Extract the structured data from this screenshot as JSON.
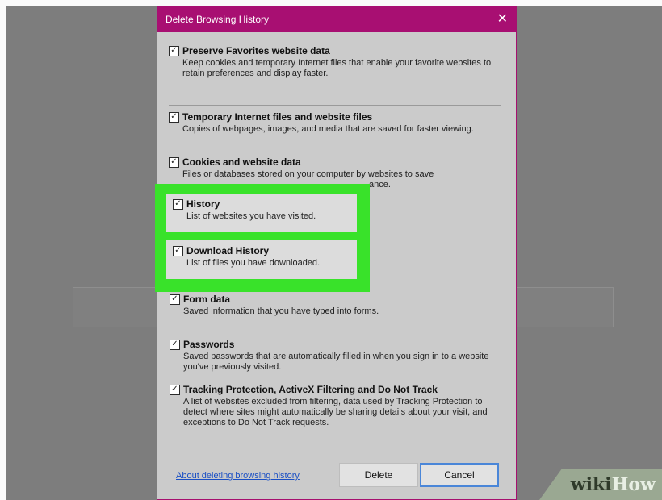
{
  "dialog": {
    "title": "Delete Browsing History",
    "close_glyph": "✕"
  },
  "options": [
    {
      "label": "Preserve Favorites website data",
      "desc": "Keep cookies and temporary Internet files that enable your favorite websites to retain preferences and display faster.",
      "checked": true
    },
    {
      "label": "Temporary Internet files and website files",
      "desc": "Copies of webpages, images, and media that are saved for faster viewing.",
      "checked": true
    },
    {
      "label": "Cookies and website data",
      "desc": "Files or databases stored on your computer by websites to save",
      "desc_tail": "ance.",
      "checked": true
    },
    {
      "label": "History",
      "desc": "List of websites you have visited.",
      "checked": true
    },
    {
      "label": "Download History",
      "desc": "List of files you have downloaded.",
      "checked": true
    },
    {
      "label": "Form data",
      "desc": "Saved information that you have typed into forms.",
      "checked": true
    },
    {
      "label": "Passwords",
      "desc": "Saved passwords that are automatically filled in when you sign in to a website you've previously visited.",
      "checked": true
    },
    {
      "label": "Tracking Protection, ActiveX Filtering and Do Not Track",
      "desc": "A list of websites excluded from filtering, data used by Tracking Protection to detect where sites might automatically be sharing details about your visit, and exceptions to Do Not Track requests.",
      "checked": true
    }
  ],
  "footer": {
    "link": "About deleting browsing history",
    "delete_label": "Delete",
    "cancel_label": "Cancel"
  },
  "watermark": {
    "wiki": "wiki",
    "how": "How"
  },
  "colors": {
    "titlebar": "#a80f72",
    "highlight": "#39e22a"
  }
}
